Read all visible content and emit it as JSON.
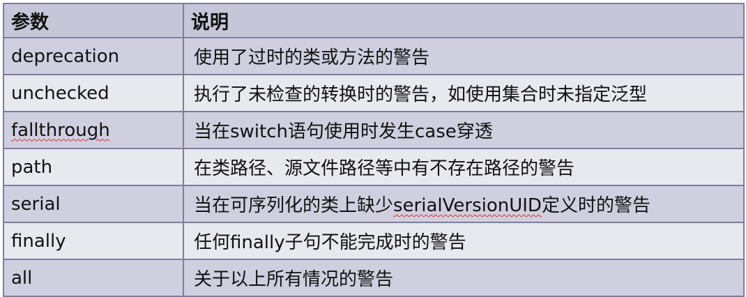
{
  "header": {
    "param": "参数",
    "desc": "说明"
  },
  "rows": [
    {
      "param": "deprecation",
      "desc": "使用了过时的类或方法的警告"
    },
    {
      "param": "unchecked",
      "desc": "执行了未检查的转换时的警告，如使用集合时未指定泛型"
    },
    {
      "param": "fallthrough",
      "desc": "当在switch语句使用时发生case穿透"
    },
    {
      "param": "path",
      "desc": "在类路径、源文件路径等中有不存在路径的警告"
    },
    {
      "param": "serial",
      "desc_pre": "当在可序列化的类上缺少",
      "desc_mark": "serialVersionUID",
      "desc_post": "定义时的警告"
    },
    {
      "param": "finally",
      "desc": "任何finally子句不能完成时的警告"
    },
    {
      "param": "all",
      "desc": "关于以上所有情况的警告"
    }
  ]
}
